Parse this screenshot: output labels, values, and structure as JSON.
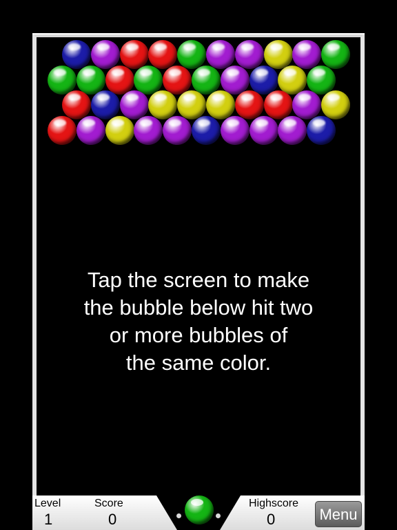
{
  "colors": {
    "red": "#e41414",
    "green": "#14b414",
    "blue": "#1c1ca8",
    "purple": "#a21cd0",
    "yellow": "#d2cf10"
  },
  "board": {
    "rows": [
      [
        "blue",
        "purple",
        "red",
        "red",
        "green",
        "purple",
        "purple",
        "yellow",
        "purple",
        "green"
      ],
      [
        "green",
        "green",
        "red",
        "green",
        "red",
        "green",
        "purple",
        "blue",
        "yellow",
        "green"
      ],
      [
        "red",
        "blue",
        "purple",
        "yellow",
        "yellow",
        "yellow",
        "red",
        "red",
        "purple",
        "yellow"
      ],
      [
        "red",
        "purple",
        "yellow",
        "purple",
        "purple",
        "blue",
        "purple",
        "purple",
        "purple",
        "blue"
      ]
    ]
  },
  "instructions": "Tap the screen to make\nthe bubble below hit two\nor more bubbles of\nthe same color.",
  "hud": {
    "level_label": "Level",
    "level_value": "1",
    "score_label": "Score",
    "score_value": "0",
    "highscore_label": "Highscore",
    "highscore_value": "0",
    "menu_label": "Menu"
  },
  "shooter": {
    "color": "green",
    "icon": "bubble-icon"
  }
}
